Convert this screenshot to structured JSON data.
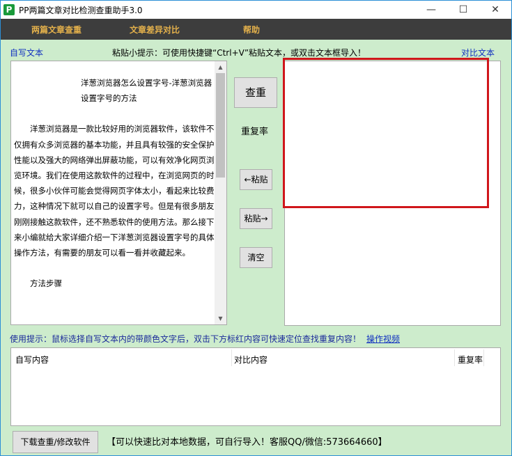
{
  "window": {
    "title": "PP两篇文章对比检测查重助手3.0",
    "minimize": "—",
    "maximize": "☐",
    "close": "✕",
    "logo": "P"
  },
  "menu": [
    "两篇文章查重",
    "文章差异对比",
    "帮助"
  ],
  "labels": {
    "self_text": "自写文本",
    "paste_tip": "粘贴小提示：可使用快捷键“Ctrl+V”粘贴文本，或双击文本框导入！",
    "compare_text": "对比文本",
    "repeat_rate": "重复率",
    "usage_tip": "使用提示：鼠标选择自写文本内的带颜色文字后，双击下方标红内容可快速定位查找重复内容！",
    "video_link": "操作视频",
    "footer_info": "【可以快速比对本地数据，可自行导入！客服QQ/微信:573664660】"
  },
  "left_text": {
    "title": "洋葱浏览器怎么设置字号-洋葱浏览器设置字号的方法",
    "paragraphs": [
      "洋葱浏览器是一款比较好用的浏览器软件，该软件不仅拥有众多浏览器的基本功能，并且具有较强的安全保护性能以及强大的网络弹出屏蔽功能，可以有效净化网页浏览环境。我们在使用这款软件的过程中，在浏览网页的时候，很多小伙伴可能会觉得网页字体太小，看起来比较费力，这种情况下就可以自己的设置字号。但是有很多朋友刚刚接触这款软件，还不熟悉软件的使用方法。那么接下来小编就给大家详细介绍一下洋葱浏览器设置字号的具体操作方法，有需要的朋友可以看一看并收藏起来。",
      "方法步骤"
    ]
  },
  "buttons": {
    "check": "查重",
    "paste_left": "←粘贴",
    "paste_right": "粘贴→",
    "clear": "清空",
    "download": "下载查重/修改软件"
  },
  "table": {
    "columns": [
      "自写内容",
      "对比内容",
      "重复率"
    ]
  }
}
